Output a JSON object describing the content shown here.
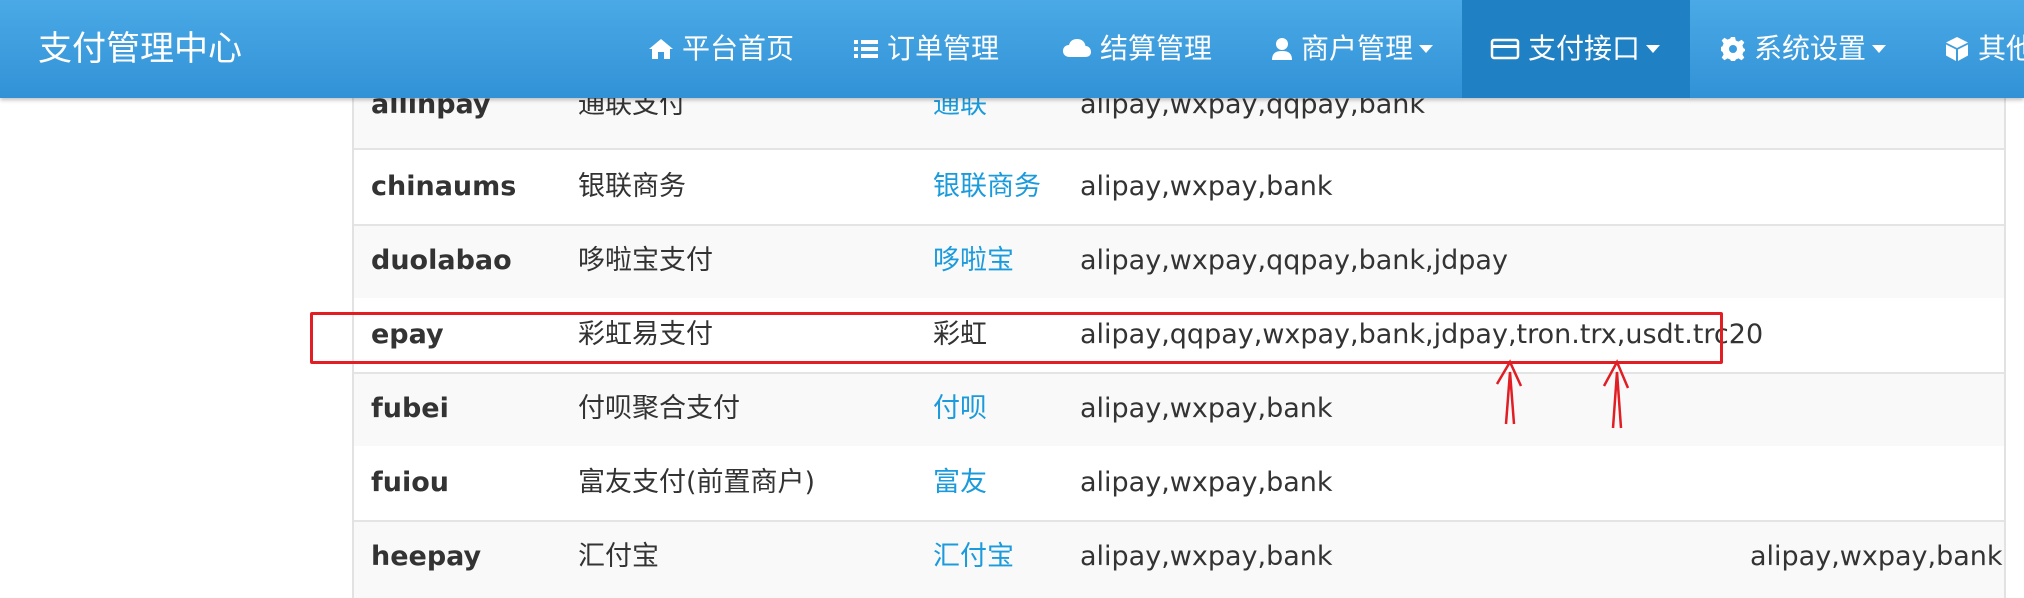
{
  "header": {
    "brand": "支付管理中心",
    "nav": [
      {
        "label": "平台首页",
        "icon": "home-icon",
        "dropdown": false
      },
      {
        "label": "订单管理",
        "icon": "list-icon",
        "dropdown": false
      },
      {
        "label": "结算管理",
        "icon": "cloud-icon",
        "dropdown": false
      },
      {
        "label": "商户管理",
        "icon": "user-icon",
        "dropdown": true
      },
      {
        "label": "支付接口",
        "icon": "credit-card-icon",
        "dropdown": true,
        "active": true
      },
      {
        "label": "系统设置",
        "icon": "gear-icon",
        "dropdown": true
      },
      {
        "label": "其他",
        "icon": "cube-icon",
        "dropdown": false
      }
    ]
  },
  "table": {
    "rows": [
      {
        "name": "allinpay",
        "showname": "通联支付",
        "company": "通联",
        "types": "alipay,wxpay,qqpay,bank",
        "extra": ""
      },
      {
        "name": "chinaums",
        "showname": "银联商务",
        "company": "银联商务",
        "types": "alipay,wxpay,bank",
        "extra": ""
      },
      {
        "name": "duolabao",
        "showname": "哆啦宝支付",
        "company": "哆啦宝",
        "types": "alipay,wxpay,qqpay,bank,jdpay",
        "extra": ""
      },
      {
        "name": "epay",
        "showname": "彩虹易支付",
        "company": "彩虹",
        "types": "alipay,qqpay,wxpay,bank,jdpay,tron.trx,usdt.trc20",
        "extra": ""
      },
      {
        "name": "fubei",
        "showname": "付呗聚合支付",
        "company": "付呗",
        "types": "alipay,wxpay,bank",
        "extra": ""
      },
      {
        "name": "fuiou",
        "showname": "富友支付(前置商户)",
        "company": "富友",
        "types": "alipay,wxpay,bank",
        "extra": ""
      },
      {
        "name": "heepay",
        "showname": "汇付宝",
        "company": "汇付宝",
        "types": "alipay,wxpay,bank",
        "extra": "alipay,wxpay,bank"
      }
    ]
  },
  "colors": {
    "header_bg": "#3a9de0",
    "link": "#1b9bdc",
    "highlight": "#e01e24"
  }
}
